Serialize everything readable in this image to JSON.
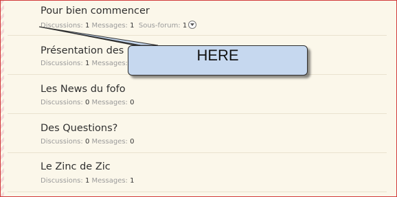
{
  "forums": [
    {
      "title": "Pour bien commencer",
      "discussions_label": "Discussions:",
      "discussions": "1",
      "messages_label": "Messages:",
      "messages": "1",
      "subforum_label": "Sous-forum:",
      "subforum": "1"
    },
    {
      "title": "Présentation des",
      "discussions_label": "Discussions:",
      "discussions": "1",
      "messages_label": "Messages:",
      "messages": ""
    },
    {
      "title": "Les News du fofo",
      "discussions_label": "Discussions:",
      "discussions": "0",
      "messages_label": "Messages:",
      "messages": "0"
    },
    {
      "title": "Des Questions?",
      "discussions_label": "Discussions:",
      "discussions": "0",
      "messages_label": "Messages:",
      "messages": "0"
    },
    {
      "title": "Le Zinc de Zic",
      "discussions_label": "Discussions:",
      "discussions": "1",
      "messages_label": "Messages:",
      "messages": "1"
    }
  ],
  "callout": {
    "text": "HERE"
  },
  "icons": {
    "subforum_expand": "chevron-down-circle-icon"
  }
}
